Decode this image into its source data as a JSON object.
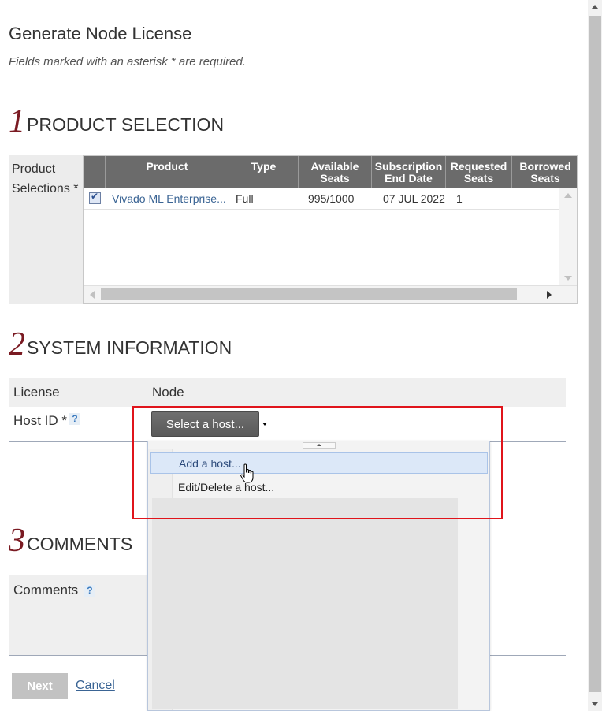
{
  "page": {
    "title": "Generate Node License",
    "required_note": "Fields marked with an asterisk * are required."
  },
  "product_selection": {
    "number": "1",
    "title": "PRODUCT SELECTION",
    "label": "Product Selections *",
    "columns": [
      "Product",
      "Type",
      "Available Seats",
      "Subscription End Date",
      "Requested Seats",
      "Borrowed Seats"
    ],
    "rows": [
      {
        "checked": true,
        "product": "Vivado ML Enterprise...",
        "type": "Full",
        "available_seats": "995/1000",
        "end_date": "07 JUL 2022",
        "requested_seats": "1",
        "borrowed_seats": ""
      }
    ]
  },
  "system_information": {
    "number": "2",
    "title": "SYSTEM INFORMATION",
    "header_license": "License",
    "header_node": "Node",
    "host_label": "Host ID *",
    "help_icon": "?",
    "host_button": "Select a host...",
    "dropdown_items": [
      "Add a host...",
      "Edit/Delete a host..."
    ]
  },
  "comments": {
    "number": "3",
    "title": "COMMENTS",
    "label": "Comments",
    "help_icon": "?"
  },
  "actions": {
    "next_label": "Next",
    "cancel_label": "Cancel"
  },
  "colors": {
    "section_number": "#7a1a22",
    "grid_header": "#6b6b6b",
    "link": "#3a6494",
    "highlight": "#e0141b",
    "menu_active": "#dce8f8"
  }
}
